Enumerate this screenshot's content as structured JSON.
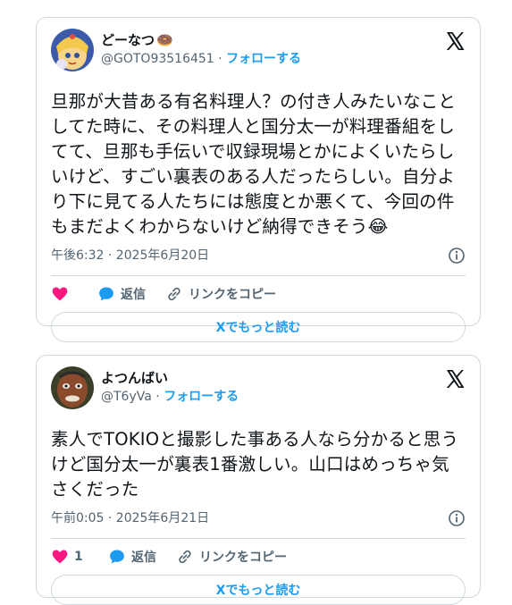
{
  "posts": [
    {
      "display_name": "どーなつ",
      "name_emoji": "🍩",
      "handle": "@GOTO93516451",
      "follow_label": "フォローする",
      "text": "旦那が大昔ある有名料理人？の付き人みたいなこと\nしてた時に、その料理人と国分太一が料理番組をし\nてて、旦那も手伝いで収録現場とかによくいたらし\nいけど、すごい裏表のある人だったらしい。自分よ\nり下に見てる人たちには態度とか悪くて、今回の件\nもまだよくわからないけど納得できそう😂",
      "timestamp": "午後6:32 · 2025年6月20日",
      "like_count": "",
      "reply_label": "返信",
      "copy_link_label": "リンクをコピー",
      "read_more_label": "Xでもっと読む"
    },
    {
      "display_name": "よつんばい",
      "name_emoji": "",
      "handle": "@T6yVa",
      "follow_label": "フォローする",
      "text": "素人でTOKIOと撮影した事ある人なら分かると思う\nけど国分太一が裏表1番激しい。山口はめっちゃ気\nさくだった",
      "timestamp": "午前0:05 · 2025年6月21日",
      "like_count": "1",
      "reply_label": "返信",
      "copy_link_label": "リンクをコピー",
      "read_more_label": "Xでもっと読む"
    }
  ],
  "colors": {
    "accent": "#1d9bf0",
    "like": "#f91880",
    "text": "#0f1419",
    "muted": "#536471",
    "border": "#cfd9de"
  },
  "icons": [
    "x-logo-icon",
    "info-icon",
    "heart-icon",
    "reply-bubble-icon",
    "link-icon"
  ]
}
